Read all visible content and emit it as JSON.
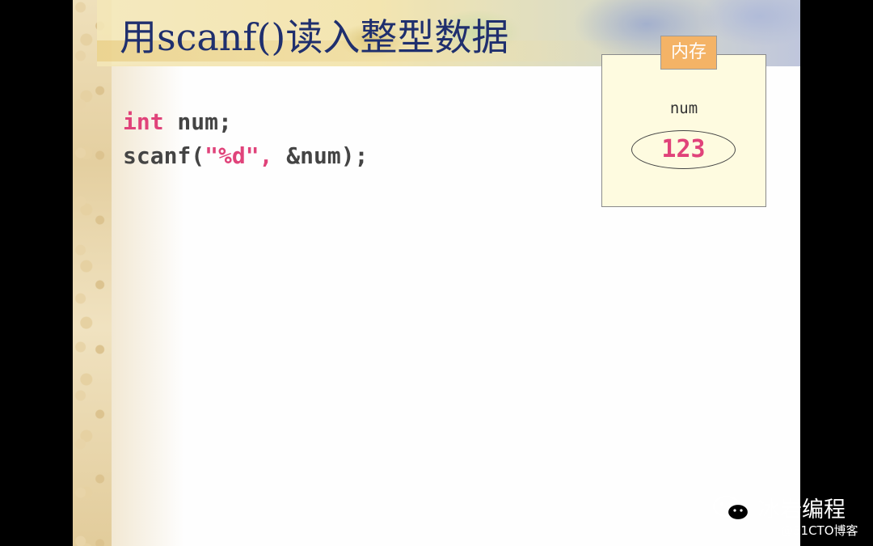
{
  "slide": {
    "title": "用scanf()读入整型数据",
    "code": {
      "line1": {
        "keyword": "int",
        "rest": " num;"
      },
      "line2": {
        "prefix": "scanf(",
        "string": "\"%d\",",
        "suffix": " &num);"
      }
    },
    "memory": {
      "label": "内存",
      "variable_name": "num",
      "variable_value": "123"
    }
  },
  "watermark": {
    "brand": "冰岩编程",
    "site": "@51CTO博客"
  },
  "colors": {
    "title": "#1f2f6e",
    "keyword": "#e0437a",
    "code": "#444444",
    "memory_tab": "#f4b366",
    "memory_box": "#fefbe0"
  },
  "icons": [
    "wechat-icon"
  ]
}
